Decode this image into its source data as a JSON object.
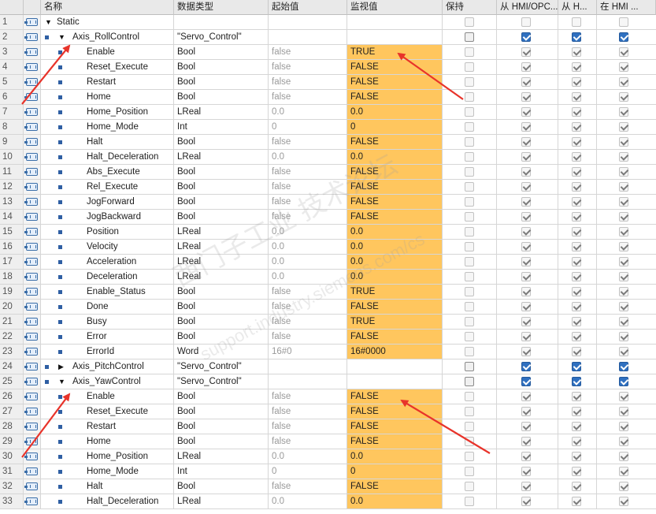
{
  "columns": {
    "name": "名称",
    "type": "数据类型",
    "start": "起始值",
    "monitor": "监视值",
    "retain": "保持",
    "hmi_access": "从 HMI/OPC...",
    "hmi_write": "从 H...",
    "hmi_visible": "在 HMI ..."
  },
  "rows": [
    {
      "n": "1",
      "level": 0,
      "expand": "down",
      "name": "Static",
      "type": "",
      "start": "",
      "mon": "",
      "kind": "section"
    },
    {
      "n": "2",
      "level": 1,
      "expand": "down",
      "name": "Axis_RollControl",
      "type": "\"Servo_Control\"",
      "start": "",
      "mon": "",
      "kind": "struct"
    },
    {
      "n": "3",
      "level": 2,
      "name": "Enable",
      "type": "Bool",
      "start": "false",
      "mon": "TRUE",
      "kind": "member"
    },
    {
      "n": "4",
      "level": 2,
      "name": "Reset_Execute",
      "type": "Bool",
      "start": "false",
      "mon": "FALSE",
      "kind": "member"
    },
    {
      "n": "5",
      "level": 2,
      "name": "Restart",
      "type": "Bool",
      "start": "false",
      "mon": "FALSE",
      "kind": "member"
    },
    {
      "n": "6",
      "level": 2,
      "name": "Home",
      "type": "Bool",
      "start": "false",
      "mon": "FALSE",
      "kind": "member"
    },
    {
      "n": "7",
      "level": 2,
      "name": "Home_Position",
      "type": "LReal",
      "start": "0.0",
      "mon": "0.0",
      "kind": "member"
    },
    {
      "n": "8",
      "level": 2,
      "name": "Home_Mode",
      "type": "Int",
      "start": "0",
      "mon": "0",
      "kind": "member"
    },
    {
      "n": "9",
      "level": 2,
      "name": "Halt",
      "type": "Bool",
      "start": "false",
      "mon": "FALSE",
      "kind": "member"
    },
    {
      "n": "10",
      "level": 2,
      "name": "Halt_Deceleration",
      "type": "LReal",
      "start": "0.0",
      "mon": "0.0",
      "kind": "member"
    },
    {
      "n": "11",
      "level": 2,
      "name": "Abs_Execute",
      "type": "Bool",
      "start": "false",
      "mon": "FALSE",
      "kind": "member"
    },
    {
      "n": "12",
      "level": 2,
      "name": "Rel_Execute",
      "type": "Bool",
      "start": "false",
      "mon": "FALSE",
      "kind": "member"
    },
    {
      "n": "13",
      "level": 2,
      "name": "JogForward",
      "type": "Bool",
      "start": "false",
      "mon": "FALSE",
      "kind": "member"
    },
    {
      "n": "14",
      "level": 2,
      "name": "JogBackward",
      "type": "Bool",
      "start": "false",
      "mon": "FALSE",
      "kind": "member"
    },
    {
      "n": "15",
      "level": 2,
      "name": "Position",
      "type": "LReal",
      "start": "0.0",
      "mon": "0.0",
      "kind": "member"
    },
    {
      "n": "16",
      "level": 2,
      "name": "Velocity",
      "type": "LReal",
      "start": "0.0",
      "mon": "0.0",
      "kind": "member"
    },
    {
      "n": "17",
      "level": 2,
      "name": "Acceleration",
      "type": "LReal",
      "start": "0.0",
      "mon": "0.0",
      "kind": "member"
    },
    {
      "n": "18",
      "level": 2,
      "name": "Deceleration",
      "type": "LReal",
      "start": "0.0",
      "mon": "0.0",
      "kind": "member"
    },
    {
      "n": "19",
      "level": 2,
      "name": "Enable_Status",
      "type": "Bool",
      "start": "false",
      "mon": "TRUE",
      "kind": "member"
    },
    {
      "n": "20",
      "level": 2,
      "name": "Done",
      "type": "Bool",
      "start": "false",
      "mon": "FALSE",
      "kind": "member"
    },
    {
      "n": "21",
      "level": 2,
      "name": "Busy",
      "type": "Bool",
      "start": "false",
      "mon": "TRUE",
      "kind": "member"
    },
    {
      "n": "22",
      "level": 2,
      "name": "Error",
      "type": "Bool",
      "start": "false",
      "mon": "FALSE",
      "kind": "member"
    },
    {
      "n": "23",
      "level": 2,
      "name": "ErrorId",
      "type": "Word",
      "start": "16#0",
      "mon": "16#0000",
      "kind": "member"
    },
    {
      "n": "24",
      "level": 1,
      "expand": "right",
      "name": "Axis_PitchControl",
      "type": "\"Servo_Control\"",
      "start": "",
      "mon": "",
      "kind": "struct"
    },
    {
      "n": "25",
      "level": 1,
      "expand": "down",
      "name": "Axis_YawControl",
      "type": "\"Servo_Control\"",
      "start": "",
      "mon": "",
      "kind": "struct"
    },
    {
      "n": "26",
      "level": 2,
      "name": "Enable",
      "type": "Bool",
      "start": "false",
      "mon": "FALSE",
      "kind": "member"
    },
    {
      "n": "27",
      "level": 2,
      "name": "Reset_Execute",
      "type": "Bool",
      "start": "false",
      "mon": "FALSE",
      "kind": "member"
    },
    {
      "n": "28",
      "level": 2,
      "name": "Restart",
      "type": "Bool",
      "start": "false",
      "mon": "FALSE",
      "kind": "member"
    },
    {
      "n": "29",
      "level": 2,
      "name": "Home",
      "type": "Bool",
      "start": "false",
      "mon": "FALSE",
      "kind": "member"
    },
    {
      "n": "30",
      "level": 2,
      "name": "Home_Position",
      "type": "LReal",
      "start": "0.0",
      "mon": "0.0",
      "kind": "member"
    },
    {
      "n": "31",
      "level": 2,
      "name": "Home_Mode",
      "type": "Int",
      "start": "0",
      "mon": "0",
      "kind": "member"
    },
    {
      "n": "32",
      "level": 2,
      "name": "Halt",
      "type": "Bool",
      "start": "false",
      "mon": "FALSE",
      "kind": "member"
    },
    {
      "n": "33",
      "level": 2,
      "name": "Halt_Deceleration",
      "type": "LReal",
      "start": "0.0",
      "mon": "0.0",
      "kind": "member"
    }
  ],
  "watermark": {
    "line1": "西门子工业 技术论坛",
    "line2": "support.industry.siemens.com/cs"
  },
  "colors": {
    "monitor_highlight": "#ffc65e",
    "checkbox_checked": "#2f70c0",
    "annotation_arrow": "#e8332a"
  },
  "icons": {
    "db_tag": "db-interface-icon",
    "bullet": "member-bullet-icon",
    "expand": "expand-triangle-icon"
  }
}
